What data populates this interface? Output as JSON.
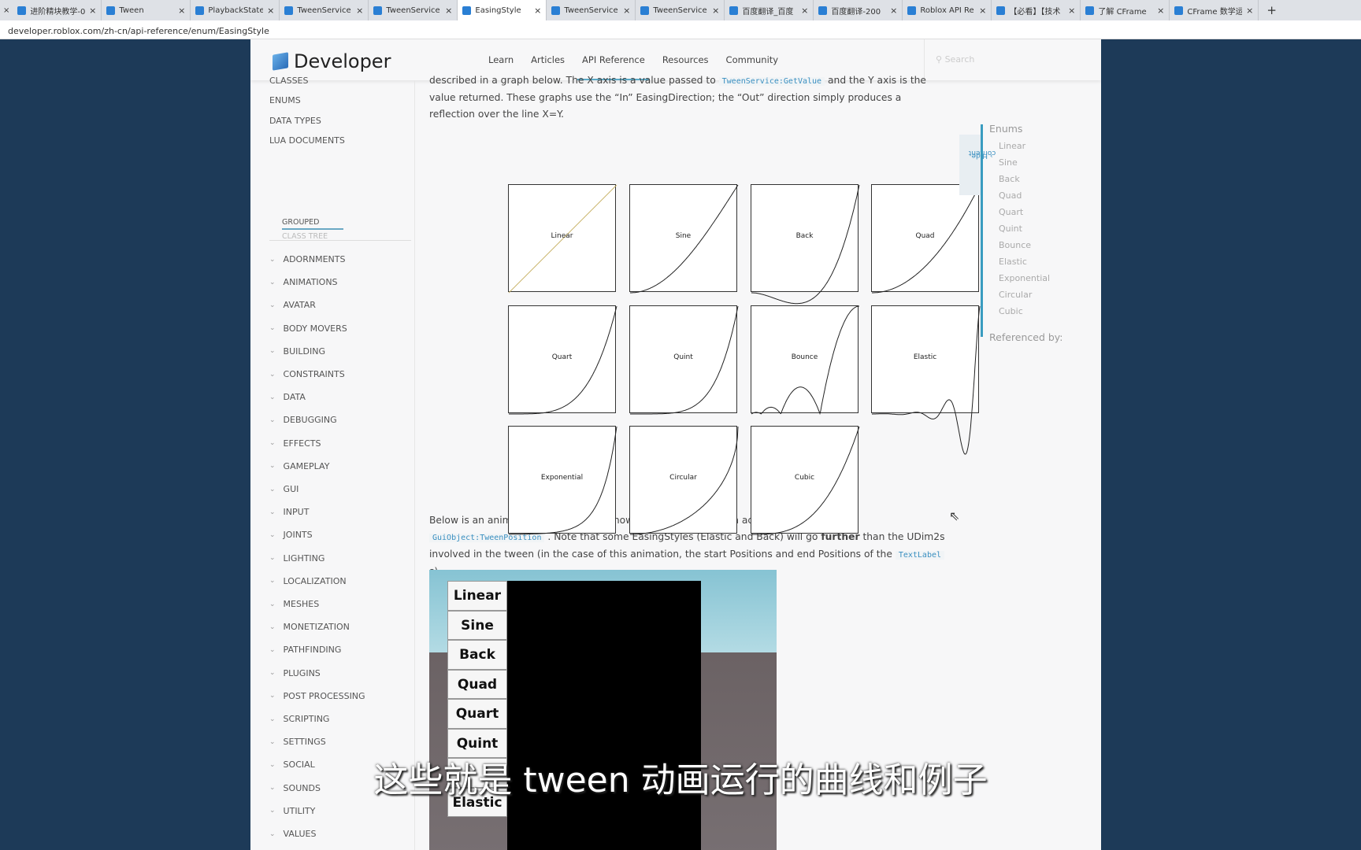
{
  "browser": {
    "tabs": [
      {
        "title": "进阶精块教学-0"
      },
      {
        "title": "Tween"
      },
      {
        "title": "PlaybackState"
      },
      {
        "title": "TweenService"
      },
      {
        "title": "TweenService"
      },
      {
        "title": "EasingStyle",
        "active": true
      },
      {
        "title": "TweenService"
      },
      {
        "title": "TweenService"
      },
      {
        "title": "百度翻译_百度"
      },
      {
        "title": "百度翻译-200"
      },
      {
        "title": "Roblox API Re"
      },
      {
        "title": "【必看】【技术"
      },
      {
        "title": "了解 CFrame"
      },
      {
        "title": "CFrame 数学运"
      }
    ],
    "url": "developer.roblox.com/zh-cn/api-reference/enum/EasingStyle",
    "new_tab": "+"
  },
  "header": {
    "logo": "Developer",
    "nav": [
      "Learn",
      "Articles",
      "API Reference",
      "Resources",
      "Community"
    ],
    "active_nav": "API Reference",
    "search_placeholder": "Search"
  },
  "sidebar": {
    "top": [
      "CLASSES",
      "ENUMS",
      "DATA TYPES",
      "LUA DOCUMENTS"
    ],
    "view_tabs": [
      "GROUPED",
      "CLASS TREE"
    ],
    "groups": [
      "ADORNMENTS",
      "ANIMATIONS",
      "AVATAR",
      "BODY MOVERS",
      "BUILDING",
      "CONSTRAINTS",
      "DATA",
      "DEBUGGING",
      "EFFECTS",
      "GAMEPLAY",
      "GUI",
      "INPUT",
      "JOINTS",
      "LIGHTING",
      "LOCALIZATION",
      "MESHES",
      "MONETIZATION",
      "PATHFINDING",
      "PLUGINS",
      "POST PROCESSING",
      "SCRIPTING",
      "SETTINGS",
      "SOCIAL",
      "SOUNDS",
      "UTILITY",
      "VALUES"
    ]
  },
  "content": {
    "p1": {
      "a": "described in a graph below. The X axis is a value passed to ",
      "code": "TweenService:GetValue",
      "b": " and the Y axis is the value returned. These graphs use the “In” EasingDirection; the “Out” direction simply produces a reflection over the line X=Y."
    },
    "graphs": [
      "Linear",
      "Sine",
      "Back",
      "Quad",
      "Quart",
      "Quint",
      "Bounce",
      "Elastic",
      "Exponential",
      "Circular",
      "Cubic"
    ],
    "p2": {
      "a": "Below is an animation demonstrating how each EasingDirection acts when used with ",
      "code1": "GuiObject:TweenPosition",
      "b": " . Note that some EasingStyles (Elastic and Back) will go ",
      "bold": "further",
      "c": " than the UDim2s involved in the tween (in the case of this animation, the start Positions and end Positions of the ",
      "code2": "TextLabel",
      "d": " s)."
    },
    "animation_labels": [
      "Linear",
      "Sine",
      "Back",
      "Quad",
      "Quart",
      "Quint",
      "",
      "Elastic"
    ]
  },
  "toc": {
    "toggle": "› Hide",
    "toggle2": "content",
    "heading": "Enums",
    "items": [
      "Linear",
      "Sine",
      "Back",
      "Quad",
      "Quart",
      "Quint",
      "Bounce",
      "Elastic",
      "Exponential",
      "Circular",
      "Cubic"
    ],
    "referenced": "Referenced by:"
  },
  "subtitle": "这些就是 tween 动画运行的曲线和例子"
}
